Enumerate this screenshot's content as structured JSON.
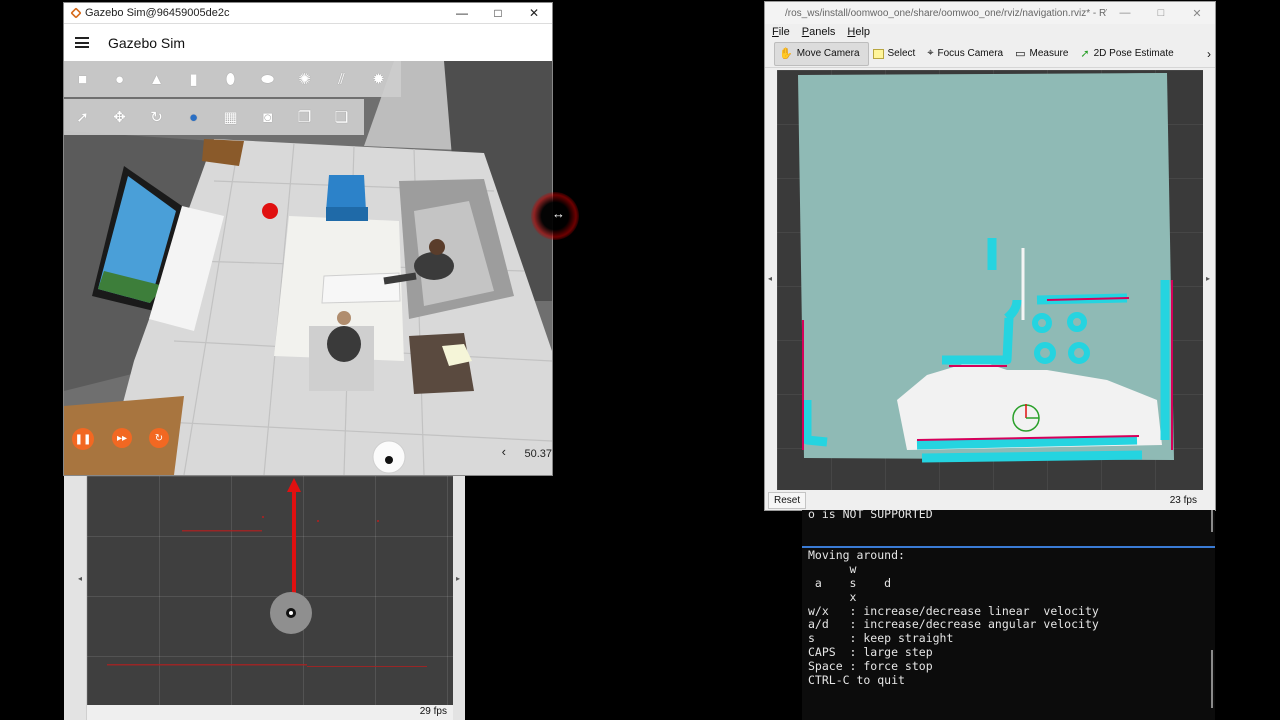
{
  "gazebo": {
    "window_title": "Gazebo Sim@96459005de2c",
    "app_title": "Gazebo Sim",
    "window_buttons": [
      "—",
      "□",
      "✕"
    ],
    "shape_tools": [
      "box-icon",
      "sphere-icon",
      "cone-icon",
      "cylinder-icon",
      "capsule-icon",
      "ellipsoid-icon",
      "sun-light-icon",
      "directional-light-icon",
      "spot-light-icon"
    ],
    "transform_tools": [
      "select-icon",
      "translate-icon",
      "rotate-icon",
      "snap-icon",
      "grid-icon",
      "screenshot-icon",
      "copy-icon",
      "paste-icon"
    ],
    "zoom_value": "50.37",
    "collapse_arrow": "‹"
  },
  "rviz": {
    "window_title": "/ros_ws/install/oomwoo_one/share/oomwoo_one/rviz/navigation.rviz* - RViz@...",
    "window_buttons": [
      "—",
      "□",
      "✕"
    ],
    "menus": [
      "File",
      "Panels",
      "Help"
    ],
    "tools": [
      {
        "label": "Move Camera",
        "active": true
      },
      {
        "label": "Select",
        "active": false
      },
      {
        "label": "Focus Camera",
        "active": false
      },
      {
        "label": "Measure",
        "active": false
      },
      {
        "label": "2D Pose Estimate",
        "active": false
      }
    ],
    "overflow": "›",
    "reset_label": "Reset",
    "fps": "23 fps"
  },
  "rviz2": {
    "fps": "29 fps"
  },
  "terminal": {
    "lines": [
      "o is NOT SUPPORTED",
      "",
      "",
      "Moving around:",
      "      w",
      " a    s    d",
      "      x",
      "w/x   : increase/decrease linear  velocity",
      "a/d   : increase/decrease angular velocity",
      "s     : keep straight",
      "CAPS  : large step",
      "Space : force stop",
      "CTRL-C to quit"
    ]
  },
  "colors": {
    "gazebo_accent": "#f26822",
    "terminal_separator": "#3a7bd5",
    "map_free": "#8fbab5",
    "costmap_inflation": "#25d4e0",
    "laser_scan": "#d6005a"
  }
}
